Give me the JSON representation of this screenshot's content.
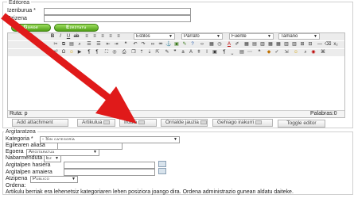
{
  "editor": {
    "legend": "Editorea",
    "title_label": "Izenburua *",
    "alias_label": "Ezizena",
    "save_btn": "Gorde",
    "cancel_btn": "Ezeztatu",
    "toolbar": {
      "styles": "Estilos",
      "paragraph": "Párrafo",
      "font": "Fuente",
      "size": "Tamaño"
    },
    "path": "Ruta: p",
    "words": "Palabras:0"
  },
  "extra_buttons": [
    {
      "label": "Add attachment"
    },
    {
      "label": "Artikulua"
    },
    {
      "label": "Irudia"
    },
    {
      "label": "Orrialde jauzia"
    },
    {
      "label": "Gehiago irakurri"
    },
    {
      "label": "Toggle editor"
    }
  ],
  "publish": {
    "legend": "Argitaratzea",
    "category_label": "Kategoria *",
    "category_value": "- Sin categoría",
    "alias_label": "Egilearen aliasa",
    "state_label": "Egoera",
    "state_value": "Argitaratua",
    "featured_label": "Nabarmenduta",
    "featured_value": "Ez",
    "start_label": "Argitalpen hasiera",
    "end_label": "Argitalpen amaiera",
    "access_label": "Atzipena",
    "access_value": "Publico",
    "order_label": "Ordena:",
    "order_text": "Artikulu berriak era lehenetsiz kategoriaren lehen posiziora joango dira. Ordena administrazio gunean aldatu daiteke."
  },
  "colors": {
    "arrow": "#e01a1a",
    "green_button": "#5fae1f"
  }
}
